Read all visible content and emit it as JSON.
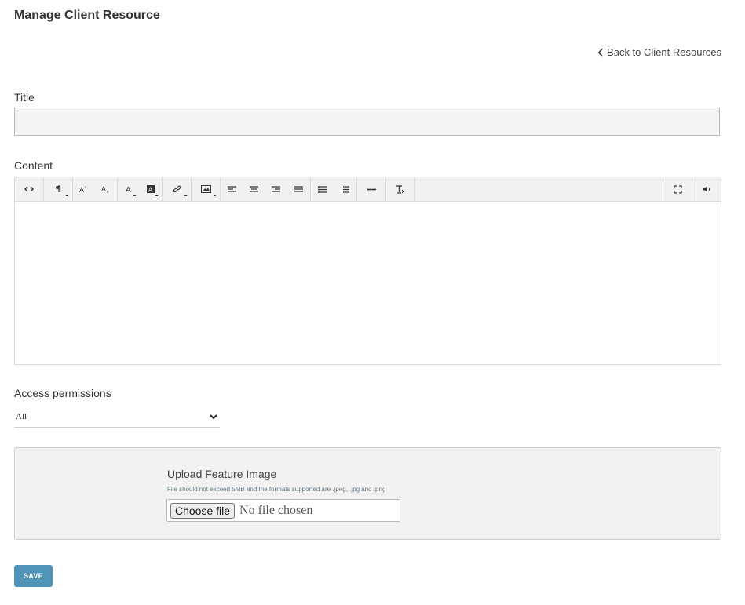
{
  "page": {
    "title": "Manage Client Resource",
    "back_link": "Back to Client Resources"
  },
  "form": {
    "title_label": "Title",
    "title_value": "",
    "content_label": "Content",
    "access_label": "Access permissions",
    "access_selected": "All",
    "upload": {
      "title": "Upload Feature Image",
      "hint": "File should not exceed 5MB and the formats supported are .jpeg, .jpg and .png",
      "choose_button": "Choose file",
      "status": "No file chosen"
    },
    "save_label": "SAVE"
  },
  "toolbar": {
    "groups": [
      [
        "code-view-icon"
      ],
      [
        "paragraph-style-icon"
      ],
      [
        "superscript-icon",
        "subscript-icon"
      ],
      [
        "font-color-icon",
        "highlight-color-icon"
      ],
      [
        "link-icon"
      ],
      [
        "image-icon"
      ],
      [
        "align-left-icon",
        "align-center-icon",
        "align-right-icon",
        "align-justify-icon"
      ],
      [
        "bulleted-list-icon",
        "numbered-list-icon"
      ],
      [
        "horizontal-rule-icon"
      ],
      [
        "clear-format-icon"
      ]
    ],
    "right": [
      "fullscreen-icon",
      "speech-icon"
    ]
  },
  "colors": {
    "accent": "#4d94b8",
    "input_bg": "#f4f4f4",
    "upload_bg": "#f2f2f2"
  }
}
